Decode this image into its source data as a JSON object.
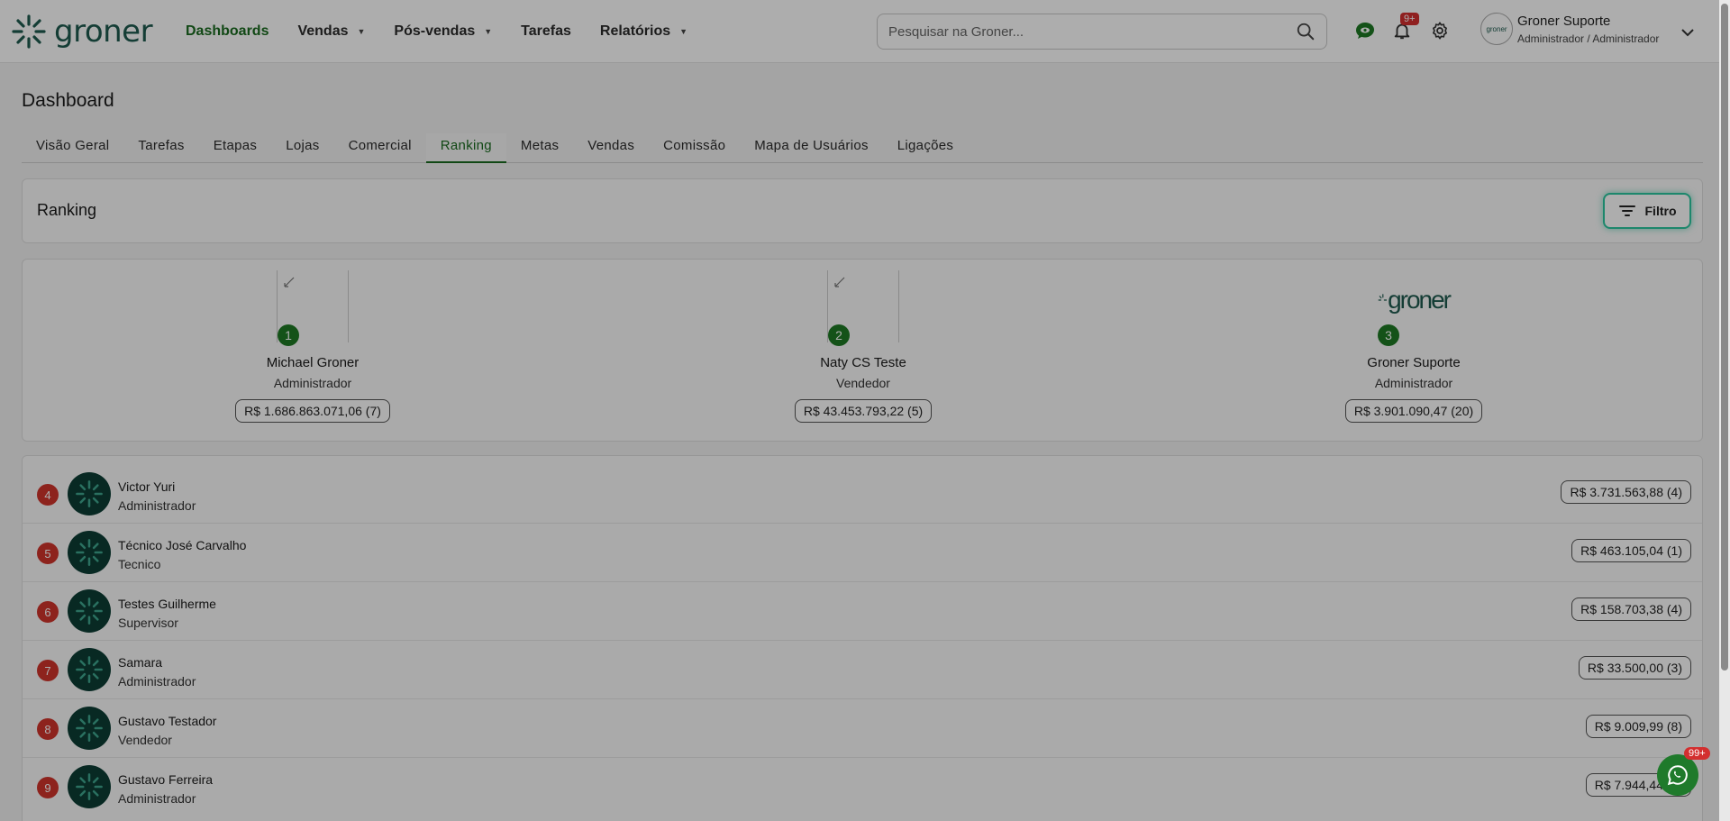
{
  "header": {
    "logo_text": "groner",
    "nav": [
      {
        "label": "Dashboards",
        "active": true,
        "has_caret": false
      },
      {
        "label": "Vendas",
        "active": false,
        "has_caret": true
      },
      {
        "label": "Pós-vendas",
        "active": false,
        "has_caret": true
      },
      {
        "label": "Tarefas",
        "active": false,
        "has_caret": false
      },
      {
        "label": "Relatórios",
        "active": false,
        "has_caret": true
      }
    ],
    "search_placeholder": "Pesquisar na Groner...",
    "notification_badge": "9+",
    "user": {
      "name": "Groner Suporte",
      "role": "Administrador / Administrador",
      "avatar_text": "groner"
    },
    "icons": [
      "chat-eye-icon",
      "bell-icon",
      "gear-icon",
      "search-icon",
      "chevron-down-icon"
    ]
  },
  "page": {
    "title": "Dashboard",
    "tabs": [
      {
        "label": "Visão Geral",
        "active": false
      },
      {
        "label": "Tarefas",
        "active": false
      },
      {
        "label": "Etapas",
        "active": false
      },
      {
        "label": "Lojas",
        "active": false
      },
      {
        "label": "Comercial",
        "active": false
      },
      {
        "label": "Ranking",
        "active": true
      },
      {
        "label": "Metas",
        "active": false
      },
      {
        "label": "Vendas",
        "active": false
      },
      {
        "label": "Comissão",
        "active": false
      },
      {
        "label": "Mapa de Usuários",
        "active": false
      },
      {
        "label": "Ligações",
        "active": false
      }
    ]
  },
  "ranking": {
    "title": "Ranking",
    "filter_label": "Filtro",
    "podium": [
      {
        "rank": "1",
        "name": "Michael Groner",
        "role": "Administrador",
        "amount": "R$ 1.686.863.071,06 (7)",
        "photo": "broken"
      },
      {
        "rank": "2",
        "name": "Naty CS Teste",
        "role": "Vendedor",
        "amount": "R$ 43.453.793,22 (5)",
        "photo": "broken"
      },
      {
        "rank": "3",
        "name": "Groner Suporte",
        "role": "Administrador",
        "amount": "R$ 3.901.090,47 (20)",
        "photo": "groner-logo",
        "photo_text": "groner"
      }
    ],
    "list": [
      {
        "rank": "4",
        "name": "Victor Yuri",
        "role": "Administrador",
        "amount": "R$ 3.731.563,88 (4)"
      },
      {
        "rank": "5",
        "name": "Técnico José Carvalho",
        "role": "Tecnico",
        "amount": "R$ 463.105,04 (1)"
      },
      {
        "rank": "6",
        "name": "Testes Guilherme",
        "role": "Supervisor",
        "amount": "R$ 158.703,38 (4)"
      },
      {
        "rank": "7",
        "name": "Samara",
        "role": "Administrador",
        "amount": "R$ 33.500,00 (3)"
      },
      {
        "rank": "8",
        "name": "Gustavo Testador",
        "role": "Vendedor",
        "amount": "R$ 9.009,99 (8)"
      },
      {
        "rank": "9",
        "name": "Gustavo Ferreira",
        "role": "Administrador",
        "amount": "R$ 7.944,44 (2)"
      }
    ]
  },
  "whatsapp": {
    "badge": "99+"
  },
  "colors": {
    "brand_green": "#1a6b1f",
    "logo_teal": "#1e5a4e",
    "rank_red": "#d0342c",
    "avatar_dark": "#0c3d34",
    "filter_glow": "#2cc7a0"
  }
}
